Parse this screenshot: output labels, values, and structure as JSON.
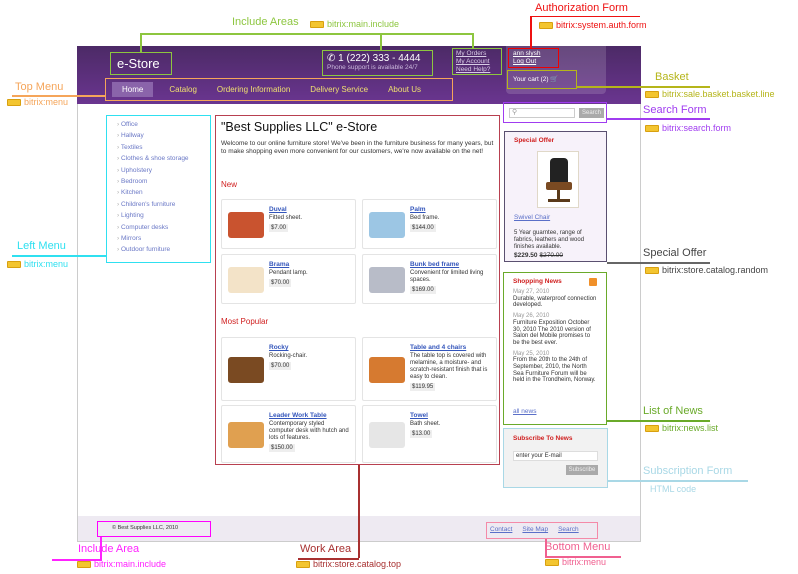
{
  "site": {
    "logo": "e-Store",
    "phone": "1 (222) 333 - 4444",
    "phone_note": "Phone support is available 24/7",
    "account_links": [
      "My Orders",
      "My Account",
      "Need Help?"
    ],
    "auth": {
      "user": "ann slysh",
      "logout": "Log Out"
    },
    "cart": "Your cart (2)",
    "top_menu": [
      "Home",
      "Catalog",
      "Ordering Information",
      "Delivery Service",
      "About Us"
    ],
    "left_menu": [
      "Office",
      "Hallway",
      "Textiles",
      "Clothes & shoe storage",
      "Upholstery",
      "Bedroom",
      "Kitchen",
      "Children's furniture",
      "Lighting",
      "Computer desks",
      "Mirrors",
      "Outdoor furniture"
    ],
    "search": {
      "placeholder": "",
      "button": "Search"
    },
    "work": {
      "title": "\"Best Supplies LLC\" e-Store",
      "intro": "Welcome to our online furniture store! We've been in the furniture business for many years, but to make shopping even more convenient for our customers, we're now available on the net!",
      "new_title": "New",
      "new_items": [
        {
          "name": "Duval",
          "desc": "Fitted sheet.",
          "price": "$7.00",
          "color": "#c9532f"
        },
        {
          "name": "Palm",
          "desc": "Bed frame.",
          "price": "$144.00",
          "color": "#9cc6e4"
        },
        {
          "name": "Brama",
          "desc": "Pendant lamp.",
          "price": "$70.00",
          "color": "#f3e3c8"
        },
        {
          "name": "Bunk bed frame",
          "desc": "Convenient for limited living spaces.",
          "price": "$169.00",
          "color": "#b8bcc8"
        }
      ],
      "popular_title": "Most Popular",
      "popular_items": [
        {
          "name": "Rocky",
          "desc": "Rocking-chair.",
          "price": "$70.00",
          "color": "#7a4a22"
        },
        {
          "name": "Table and 4 chairs",
          "desc": "The table top is covered with melamine, a moisture- and scratch-resistant finish that is easy to clean.",
          "price": "$119.95",
          "color": "#d67a30"
        },
        {
          "name": "Leader Work Table",
          "desc": "Contemporary styled computer desk with hutch and lots of features.",
          "price": "$150.00",
          "color": "#e0a050"
        },
        {
          "name": "Towel",
          "desc": "Bath sheet.",
          "price": "$13.00",
          "color": "#e6e6e6"
        }
      ]
    },
    "special_offer": {
      "title": "Special Offer",
      "name": "Swivel Chair",
      "desc": "5 Year guarntee, range of fabrics, leathers and wood finishes available.",
      "price": "$229.50",
      "old_price": "$270.00"
    },
    "news": {
      "title": "Shopping News",
      "items": [
        {
          "date": "May 27, 2010",
          "text": "Durable, waterproof connection developed."
        },
        {
          "date": "May 26, 2010",
          "text": "Furniture Exposition October 30, 2010 The 2010 version of Salon del Mobile promises to be the best ever."
        },
        {
          "date": "May 25, 2010",
          "text": "From the 20th to the 24th of September, 2010, the North Sea Furniture Forum will be held in the Trondheim, Norway."
        }
      ],
      "all": "all news"
    },
    "subscribe": {
      "title": "Subscribe To News",
      "placeholder": "enter your E-mail",
      "button": "Subscribe"
    },
    "copyright": "© Best Supplies LLC, 2010",
    "bottom_menu": [
      "Contact",
      "Site Map",
      "Search"
    ]
  },
  "annotations": {
    "include_areas": {
      "label": "Include Areas",
      "component": "bitrix:main.include",
      "color": "#8dc63f"
    },
    "auth_form": {
      "label": "Authorization Form",
      "component": "bitrix:system.auth.form",
      "color": "#ee1111"
    },
    "basket": {
      "label": "Basket",
      "component": "bitrix:sale.basket.basket.line",
      "color": "#b5b51a"
    },
    "search_form": {
      "label": "Search Form",
      "component": "bitrix:search.form",
      "color": "#a03cf0"
    },
    "special_offer": {
      "label": "Special Offer",
      "component": "bitrix:store.catalog.random",
      "color": "#444444"
    },
    "news_list": {
      "label": "List of News",
      "component": "bitrix:news.list",
      "color": "#6aaa2a"
    },
    "subscription": {
      "label": "Subscription Form",
      "component": "HTML code",
      "color": "#a9d8e6"
    },
    "top_menu": {
      "label": "Top Menu",
      "component": "bitrix:menu",
      "color": "#f5a55a"
    },
    "left_menu": {
      "label": "Left Menu",
      "component": "bitrix:menu",
      "color": "#2fe0f0"
    },
    "include_area": {
      "label": "Include Area",
      "component": "bitrix:main.include",
      "color": "#ff22ff"
    },
    "work_area": {
      "label": "Work Area",
      "component": "bitrix:store.catalog.top",
      "color": "#a83030"
    },
    "bottom_menu": {
      "label": "Bottom Menu",
      "component": "bitrix:menu",
      "color": "#f06090"
    }
  }
}
